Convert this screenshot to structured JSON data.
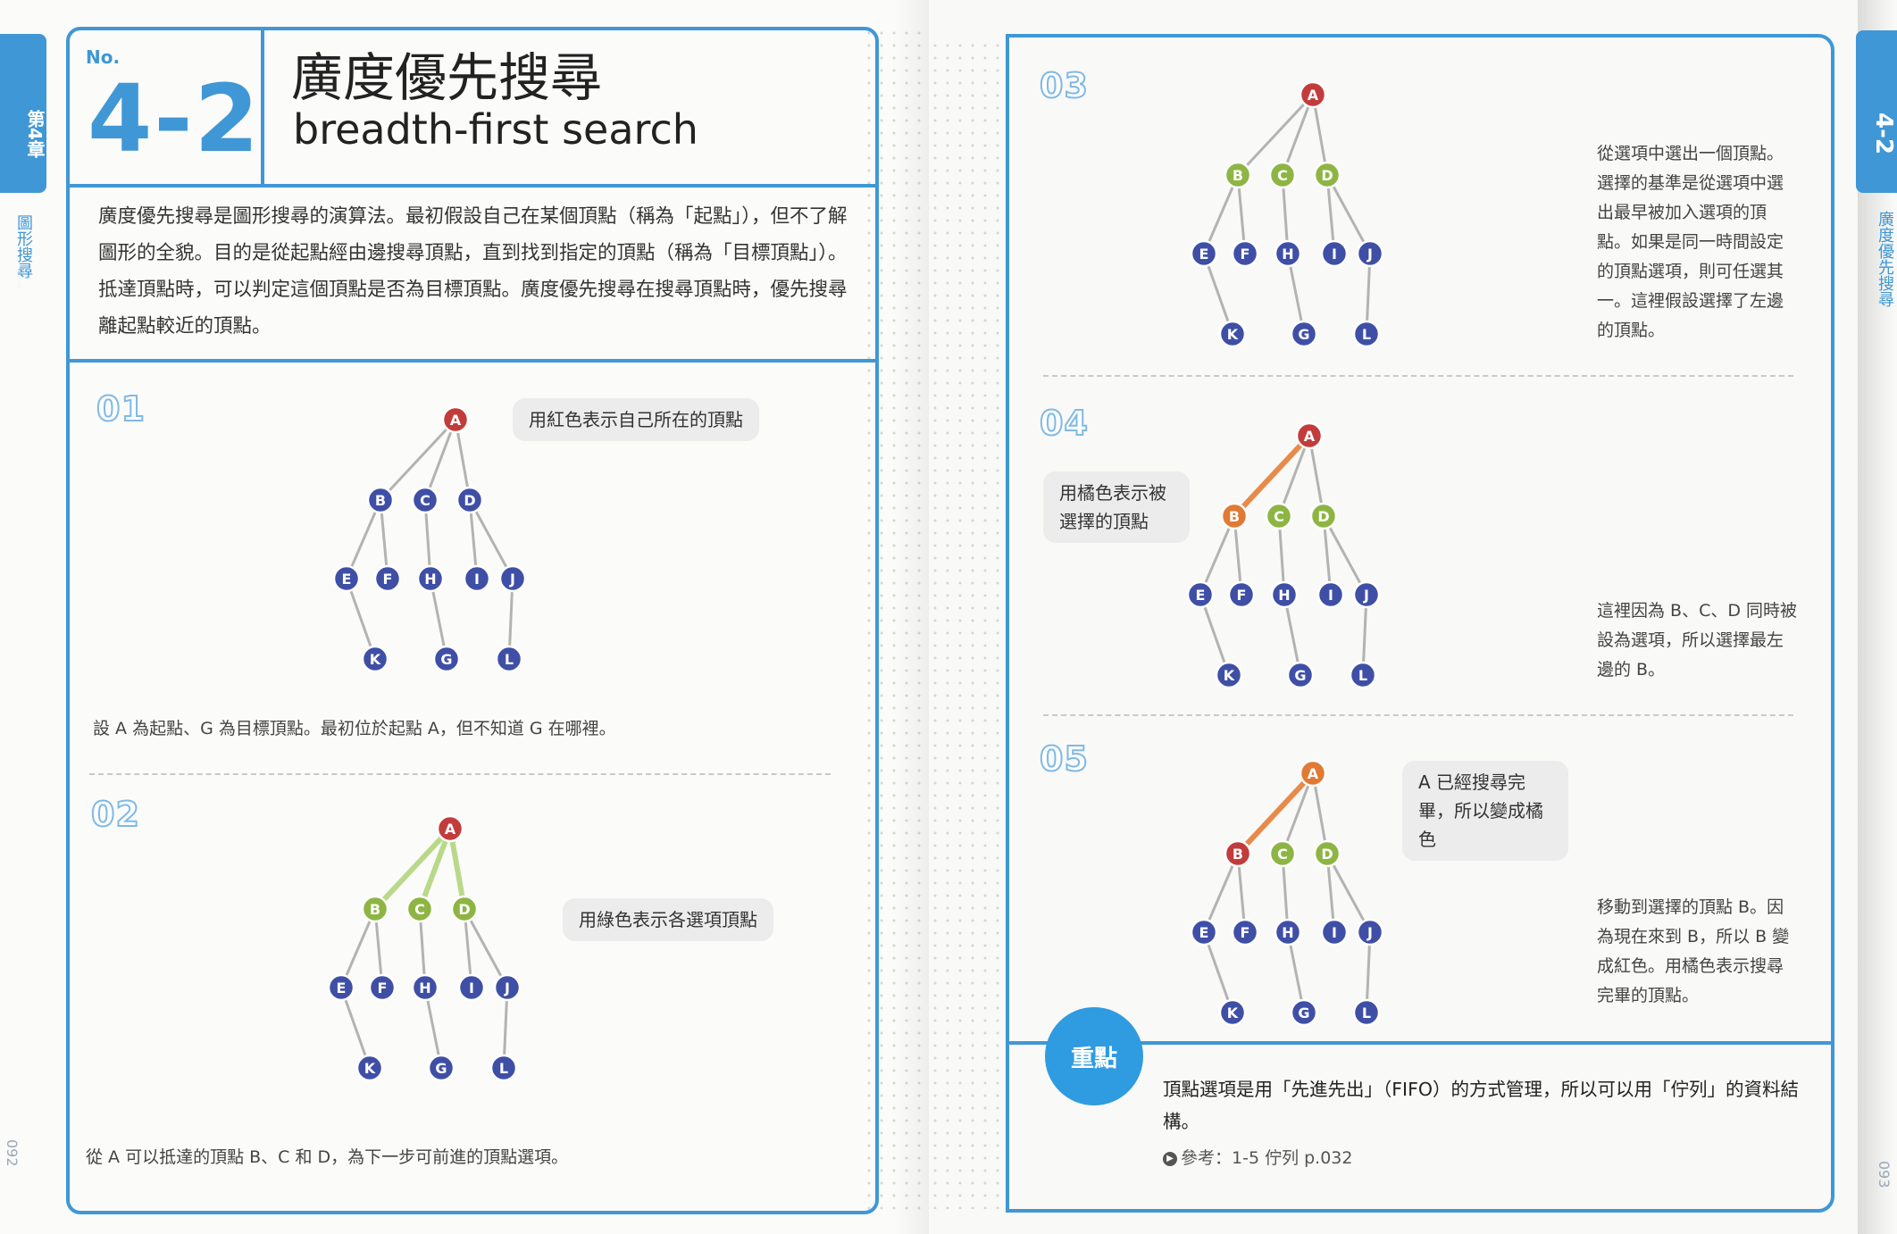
{
  "left_page": {
    "chapter_tab": "第4章",
    "chapter_subtitle": "圖形搜尋",
    "page_number": "092",
    "section": {
      "no_label": "No.",
      "number": "4-2",
      "title_zh": "廣度優先搜尋",
      "title_en": "breadth-first search"
    },
    "intro": "廣度優先搜尋是圖形搜尋的演算法。最初假設自己在某個頂點（稱為「起點」），但不了解圖形的全貌。目的是從起點經由邊搜尋頂點，直到找到指定的頂點（稱為「目標頂點」）。抵達頂點時，可以判定這個頂點是否為目標頂點。廣度優先搜尋在搜尋頂點時，優先搜尋離起點較近的頂點。",
    "steps": [
      {
        "label": "01",
        "bubble": "用紅色表示自己所在的頂點",
        "caption": "設 A 為起點、G 為目標頂點。最初位於起點 A，但不知道 G 在哪裡。"
      },
      {
        "label": "02",
        "bubble": "用綠色表示各選項頂點",
        "caption": "從 A 可以抵達的頂點 B、C 和 D，為下一步可前進的頂點選項。"
      }
    ]
  },
  "right_page": {
    "chapter_tab": "4-2",
    "chapter_subtitle": "廣度優先搜尋",
    "page_number": "093",
    "steps": [
      {
        "label": "03",
        "caption": "從選項中選出一個頂點。選擇的基準是從選項中選出最早被加入選項的頂點。如果是同一時間設定的頂點選項，則可任選其一。這裡假設選擇了左邊的頂點。"
      },
      {
        "label": "04",
        "bubble": "用橘色表示被選擇的頂點",
        "caption": "這裡因為 B、C、D 同時被設為選項，所以選擇最左邊的 B。"
      },
      {
        "label": "05",
        "bubble": "A 已經搜尋完畢，所以變成橘色",
        "caption": "移動到選擇的頂點 B。因為現在來到 B，所以 B 變成紅色。用橘色表示搜尋完畢的頂點。"
      }
    ],
    "point": {
      "badge": "重點",
      "text": "頂點選項是用「先進先出」（FIFO）的方式管理，所以可以用「佇列」的資料結構。",
      "ref": "參考：1-5 佇列 p.032"
    }
  },
  "graph": {
    "nodes": [
      "A",
      "B",
      "C",
      "D",
      "E",
      "F",
      "H",
      "I",
      "J",
      "K",
      "G",
      "L"
    ],
    "edges": [
      [
        "A",
        "B"
      ],
      [
        "A",
        "C"
      ],
      [
        "A",
        "D"
      ],
      [
        "B",
        "E"
      ],
      [
        "B",
        "F"
      ],
      [
        "C",
        "H"
      ],
      [
        "D",
        "I"
      ],
      [
        "D",
        "J"
      ],
      [
        "E",
        "K"
      ],
      [
        "H",
        "G"
      ],
      [
        "J",
        "L"
      ]
    ]
  },
  "graph_states": [
    {
      "colors": {
        "A": "red"
      },
      "edge_colors": {}
    },
    {
      "colors": {
        "A": "red",
        "B": "green",
        "C": "green",
        "D": "green"
      },
      "edge_colors": {
        "A-B": "green",
        "A-C": "green",
        "A-D": "green"
      }
    },
    {
      "colors": {
        "A": "red",
        "B": "green",
        "C": "green",
        "D": "green"
      },
      "edge_colors": {}
    },
    {
      "colors": {
        "A": "red",
        "B": "orange",
        "C": "green",
        "D": "green"
      },
      "edge_colors": {
        "A-B": "orange"
      }
    },
    {
      "colors": {
        "A": "orange",
        "B": "red",
        "C": "green",
        "D": "green"
      },
      "edge_colors": {
        "A-B": "orange"
      }
    }
  ],
  "palette": {
    "blue_frame": "#3f97d6",
    "node_default": "#3f4fa6",
    "red": "#c23c3c",
    "green": "#8db543",
    "orange": "#e07a35",
    "edge_default": "#b3b3b3",
    "edge_green": "#b9d98a",
    "edge_orange": "#e78a4a"
  }
}
